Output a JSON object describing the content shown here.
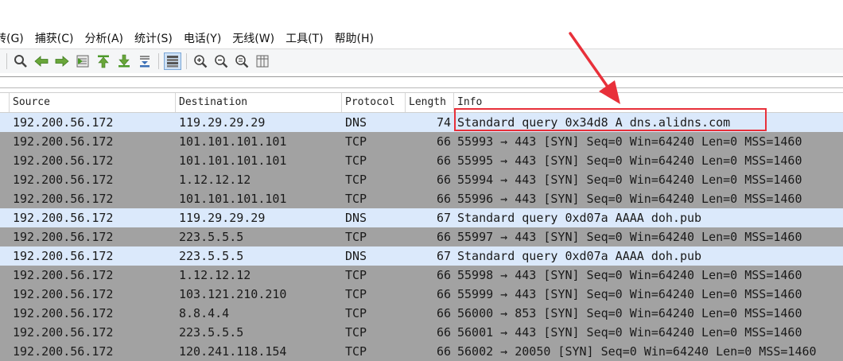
{
  "menu": [
    {
      "label": "转(G)"
    },
    {
      "label": "捕获(C)"
    },
    {
      "label": "分析(A)"
    },
    {
      "label": "统计(S)"
    },
    {
      "label": "电话(Y)"
    },
    {
      "label": "无线(W)"
    },
    {
      "label": "工具(T)"
    },
    {
      "label": "帮助(H)"
    }
  ],
  "toolbar": {
    "icons": [
      "find-packet-icon",
      "go-back-icon",
      "go-forward-icon",
      "go-to-packet-icon",
      "go-first-icon",
      "go-last-icon",
      "auto-scroll-icon",
      "colorize-icon",
      "zoom-in-icon",
      "zoom-out-icon",
      "zoom-normal-icon",
      "resize-columns-icon"
    ]
  },
  "columns": {
    "source": "Source",
    "destination": "Destination",
    "protocol": "Protocol",
    "length": "Length",
    "info": "Info"
  },
  "packets": [
    {
      "source": "192.200.56.172",
      "destination": "119.29.29.29",
      "protocol": "DNS",
      "length": "74",
      "info": "Standard query 0x34d8 A dns.alidns.com"
    },
    {
      "source": "192.200.56.172",
      "destination": "101.101.101.101",
      "protocol": "TCP",
      "length": "66",
      "info": "55993 → 443 [SYN] Seq=0 Win=64240 Len=0 MSS=1460"
    },
    {
      "source": "192.200.56.172",
      "destination": "101.101.101.101",
      "protocol": "TCP",
      "length": "66",
      "info": "55995 → 443 [SYN] Seq=0 Win=64240 Len=0 MSS=1460"
    },
    {
      "source": "192.200.56.172",
      "destination": "1.12.12.12",
      "protocol": "TCP",
      "length": "66",
      "info": "55994 → 443 [SYN] Seq=0 Win=64240 Len=0 MSS=1460"
    },
    {
      "source": "192.200.56.172",
      "destination": "101.101.101.101",
      "protocol": "TCP",
      "length": "66",
      "info": "55996 → 443 [SYN] Seq=0 Win=64240 Len=0 MSS=1460"
    },
    {
      "source": "192.200.56.172",
      "destination": "119.29.29.29",
      "protocol": "DNS",
      "length": "67",
      "info": "Standard query 0xd07a AAAA doh.pub"
    },
    {
      "source": "192.200.56.172",
      "destination": "223.5.5.5",
      "protocol": "TCP",
      "length": "66",
      "info": "55997 → 443 [SYN] Seq=0 Win=64240 Len=0 MSS=1460"
    },
    {
      "source": "192.200.56.172",
      "destination": "223.5.5.5",
      "protocol": "DNS",
      "length": "67",
      "info": "Standard query 0xd07a AAAA doh.pub"
    },
    {
      "source": "192.200.56.172",
      "destination": "1.12.12.12",
      "protocol": "TCP",
      "length": "66",
      "info": "55998 → 443 [SYN] Seq=0 Win=64240 Len=0 MSS=1460"
    },
    {
      "source": "192.200.56.172",
      "destination": "103.121.210.210",
      "protocol": "TCP",
      "length": "66",
      "info": "55999 → 443 [SYN] Seq=0 Win=64240 Len=0 MSS=1460"
    },
    {
      "source": "192.200.56.172",
      "destination": "8.8.4.4",
      "protocol": "TCP",
      "length": "66",
      "info": "56000 → 853 [SYN] Seq=0 Win=64240 Len=0 MSS=1460"
    },
    {
      "source": "192.200.56.172",
      "destination": "223.5.5.5",
      "protocol": "TCP",
      "length": "66",
      "info": "56001 → 443 [SYN] Seq=0 Win=64240 Len=0 MSS=1460"
    },
    {
      "source": "192.200.56.172",
      "destination": "120.241.118.154",
      "protocol": "TCP",
      "length": "66",
      "info": "56002 → 20050 [SYN] Seq=0 Win=64240 Len=0 MSS=1460"
    }
  ],
  "colors": {
    "dns_row": "#dbe9fb",
    "tcp_row": "#a2a2a2",
    "annotation": "#e8303a"
  }
}
